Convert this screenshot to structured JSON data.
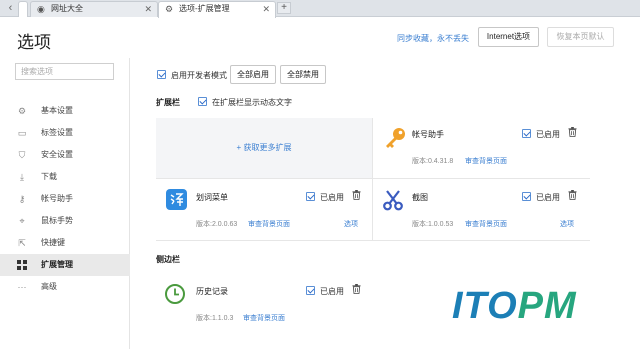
{
  "tabs": [
    {
      "label": "网址大全",
      "icon": "globe-icon"
    },
    {
      "label": "选项-扩展管理",
      "icon": "gear-icon"
    }
  ],
  "header": {
    "title": "选项",
    "sync_link": "同步收藏，永不丢失",
    "internet_options": "Internet选项",
    "restore_defaults": "恢复本页默认"
  },
  "sidebar": {
    "search_placeholder": "搜索选项",
    "items": [
      {
        "label": "基本设置",
        "icon": "gear-icon"
      },
      {
        "label": "标签设置",
        "icon": "tab-icon"
      },
      {
        "label": "安全设置",
        "icon": "shield-icon"
      },
      {
        "label": "下载",
        "icon": "download-icon"
      },
      {
        "label": "帐号助手",
        "icon": "key-icon"
      },
      {
        "label": "鼠标手势",
        "icon": "mouse-icon"
      },
      {
        "label": "快捷键",
        "icon": "shortcut-icon"
      },
      {
        "label": "扩展管理",
        "icon": "grid-icon"
      },
      {
        "label": "高级",
        "icon": "more-icon"
      }
    ],
    "active_index": 7
  },
  "main": {
    "dev_mode_label": "启用开发者模式",
    "enable_all": "全部启用",
    "disable_all": "全部禁用",
    "extension_bar_label": "扩展栏",
    "show_dynamic_text": "在扩展栏显示动态文字",
    "get_more": "+ 获取更多扩展",
    "sidebar_section_label": "侧边栏",
    "enabled_label": "已启用",
    "version_prefix": "版本:",
    "bg_page_link": "审查背景页面",
    "options_link": "选项",
    "extensions": [
      {
        "name": "帐号助手",
        "version": "版本:0.4.31.8",
        "link": "审查背景页面",
        "icon": "key-icon",
        "enabled": "已启用"
      },
      {
        "name": "划词菜单",
        "version": "版本:2.0.0.63",
        "link": "审查背景页面",
        "options": "选项",
        "icon": "translate-icon",
        "enabled": "已启用"
      },
      {
        "name": "截图",
        "version": "版本:1.0.0.53",
        "link": "审查背景页面",
        "options": "选项",
        "icon": "scissors-icon",
        "enabled": "已启用"
      }
    ],
    "sidebar_extensions": [
      {
        "name": "历史记录",
        "version": "版本:1.1.0.3",
        "link": "审查背景页面",
        "icon": "clock-icon",
        "enabled": "已启用"
      }
    ]
  },
  "watermark": {
    "part1": "ITO",
    "part2": "PM"
  },
  "colors": {
    "accent": "#3b7fd1",
    "key_orange": "#f0a12b",
    "scissors_blue": "#3a5bbf",
    "clock_green": "#4a9a3e"
  }
}
